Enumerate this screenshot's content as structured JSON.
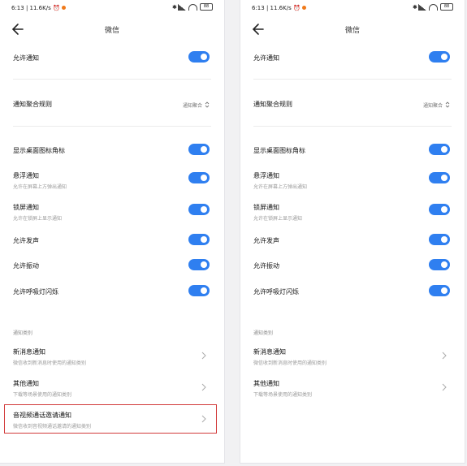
{
  "status": {
    "time": "6:13",
    "speed": "11.6K/s",
    "bt": "✱",
    "battery": "88"
  },
  "header": {
    "title": "微信"
  },
  "settings": {
    "allow_notify": "允许通知",
    "group_rule": {
      "label": "通知聚合规则",
      "value": "通知聚合"
    },
    "badge": "显示桌面图标角标",
    "float": {
      "label": "悬浮通知",
      "sub": "允许在屏幕上方弹出通知"
    },
    "lock": {
      "label": "锁屏通知",
      "sub": "允许在锁屏上显示通知"
    },
    "sound": "允许发声",
    "vibrate": "允许振动",
    "breath": "允许呼吸灯闪烁"
  },
  "categories": {
    "section_label": "通知类别",
    "new_msg": {
      "label": "新消息通知",
      "sub": "微信收到新消息时使用的通知类别"
    },
    "other": {
      "label": "其他通知",
      "sub": "下载等场景使用的通知类别"
    },
    "av_call": {
      "label": "音视频通话邀请通知",
      "sub": "微信收到音视频通话邀请的通知类别"
    }
  },
  "colors": {
    "accent": "#2f7ff0",
    "highlight": "#d23a3a"
  }
}
